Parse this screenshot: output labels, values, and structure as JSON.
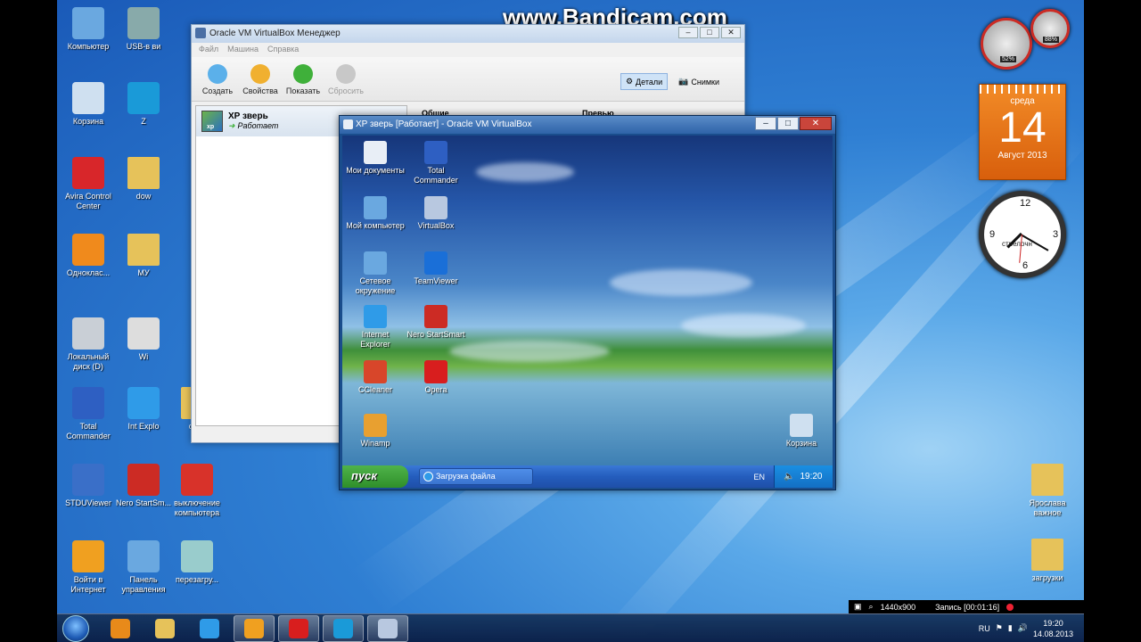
{
  "watermark": "www.Bandicam.com",
  "desktop_icons": [
    {
      "label": "Компьютер",
      "icon": "computer-icon",
      "color": "#6aa8e0"
    },
    {
      "label": "USB-в ви",
      "icon": "usb-icon",
      "color": "#8aa"
    },
    {
      "label": "Корзина",
      "icon": "recycle-bin-icon",
      "color": "#cfe0f0"
    },
    {
      "label": "Z",
      "icon": "z-icon",
      "color": "#1a9ad8"
    },
    {
      "label": "Avira Control Center",
      "icon": "avira-icon",
      "color": "#d8262a"
    },
    {
      "label": "dow",
      "icon": "folder-icon",
      "color": "#e6c25a"
    },
    {
      "label": "Одноклас...",
      "icon": "odnoklassniki-icon",
      "color": "#f08a1c"
    },
    {
      "label": "МУ",
      "icon": "folder-icon",
      "color": "#e6c25a"
    },
    {
      "label": "Локальный диск (D)",
      "icon": "drive-icon",
      "color": "#c9cfd6"
    },
    {
      "label": "Wi",
      "icon": "app-icon",
      "color": "#ddd"
    },
    {
      "label": "Total Commander",
      "icon": "floppy-icon",
      "color": "#2e5fc2"
    },
    {
      "label": "Int Explo",
      "icon": "ie-icon",
      "color": "#2f9be8"
    },
    {
      "label": "стол",
      "icon": "folder-icon",
      "color": "#e6c25a"
    },
    {
      "label": "STDUViewer",
      "icon": "stduviewer-icon",
      "color": "#3a6fc8"
    },
    {
      "label": "Nero StartSm...",
      "icon": "nero-icon",
      "color": "#cc2b24"
    },
    {
      "label": "выключение компьютера",
      "icon": "power-icon",
      "color": "#d8322a"
    },
    {
      "label": "Войти в Интернет",
      "icon": "internet-icon",
      "color": "#f0a020"
    },
    {
      "label": "Панель управления",
      "icon": "control-panel-icon",
      "color": "#6aa8e0"
    },
    {
      "label": "перезагру...",
      "icon": "restart-icon",
      "color": "#9cc"
    },
    {
      "label": "Ярослава важное",
      "icon": "folder-icon",
      "color": "#e6c25a"
    },
    {
      "label": "загрузки",
      "icon": "folder-icon",
      "color": "#e6c25a"
    }
  ],
  "vbox_manager": {
    "title": "Oracle VM VirtualBox Менеджер",
    "menu": [
      "Файл",
      "Машина",
      "Справка"
    ],
    "tools": [
      {
        "label": "Создать",
        "icon": "create-icon",
        "color": "#5bb0ea",
        "disabled": false
      },
      {
        "label": "Свойства",
        "icon": "settings-gear-icon",
        "color": "#f0b030",
        "disabled": false
      },
      {
        "label": "Показать",
        "icon": "show-arrow-icon",
        "color": "#3fb03a",
        "disabled": false
      },
      {
        "label": "Сбросить",
        "icon": "discard-arrow-icon",
        "color": "#c8c8c8",
        "disabled": true
      }
    ],
    "details_button": "Детали",
    "snapshots_button": "Снимки",
    "vm": {
      "name": "XP зверь",
      "state": "Работает"
    },
    "pane_general": "Общие",
    "pane_preview": "Превью"
  },
  "xp_window": {
    "title": "XP зверь [Работает] - Oracle VM VirtualBox",
    "icons": [
      {
        "label": "Мои документы",
        "icon": "my-documents-icon",
        "color": "#e8eef6"
      },
      {
        "label": "Total Commander",
        "icon": "floppy-icon",
        "color": "#2e5fc2"
      },
      {
        "label": "Мой компьютер",
        "icon": "my-computer-icon",
        "color": "#6aa8e0"
      },
      {
        "label": "VirtualBox",
        "icon": "virtualbox-icon",
        "color": "#b8c8e0"
      },
      {
        "label": "Сетевое окружение",
        "icon": "network-icon",
        "color": "#6aa8e0"
      },
      {
        "label": "TeamViewer",
        "icon": "teamviewer-icon",
        "color": "#1a6fd8"
      },
      {
        "label": "Internet Explorer",
        "icon": "ie-icon",
        "color": "#2f9be8"
      },
      {
        "label": "Nero StartSmart",
        "icon": "nero-icon",
        "color": "#cc2b24"
      },
      {
        "label": "CCleaner",
        "icon": "ccleaner-icon",
        "color": "#d8462a"
      },
      {
        "label": "Opera",
        "icon": "opera-icon",
        "color": "#d81e1e"
      },
      {
        "label": "Winamp",
        "icon": "winamp-icon",
        "color": "#e8a030"
      },
      {
        "label": "Корзина",
        "icon": "recycle-bin-icon",
        "color": "#cfe0f0"
      }
    ],
    "start_label": "пуск",
    "taskbar_item": "Загрузка файла",
    "lang": "EN",
    "time": "19:20"
  },
  "gadgets": {
    "cpu_percent": "52%",
    "mem_percent": "88%",
    "calendar_day": "среда",
    "calendar_date": "14",
    "calendar_month": "Август 2013",
    "clock_label": "стрелочн"
  },
  "bandicam_bar": {
    "resolution": "1440x900",
    "record": "Запись [00:01:16]"
  },
  "taskbar": {
    "apps": [
      {
        "icon": "media-player-icon",
        "color": "#e88a1a"
      },
      {
        "icon": "explorer-folder-icon",
        "color": "#e6c25a"
      },
      {
        "icon": "ie-icon",
        "color": "#2f9be8"
      },
      {
        "icon": "internet-icon",
        "color": "#f0a020"
      },
      {
        "icon": "yandex-icon",
        "color": "#d81e1e"
      },
      {
        "icon": "z-icon",
        "color": "#1a9ad8"
      },
      {
        "icon": "virtualbox-icon",
        "color": "#b8c8e0"
      }
    ],
    "lang": "RU",
    "time": "19:20",
    "date": "14.08.2013"
  }
}
